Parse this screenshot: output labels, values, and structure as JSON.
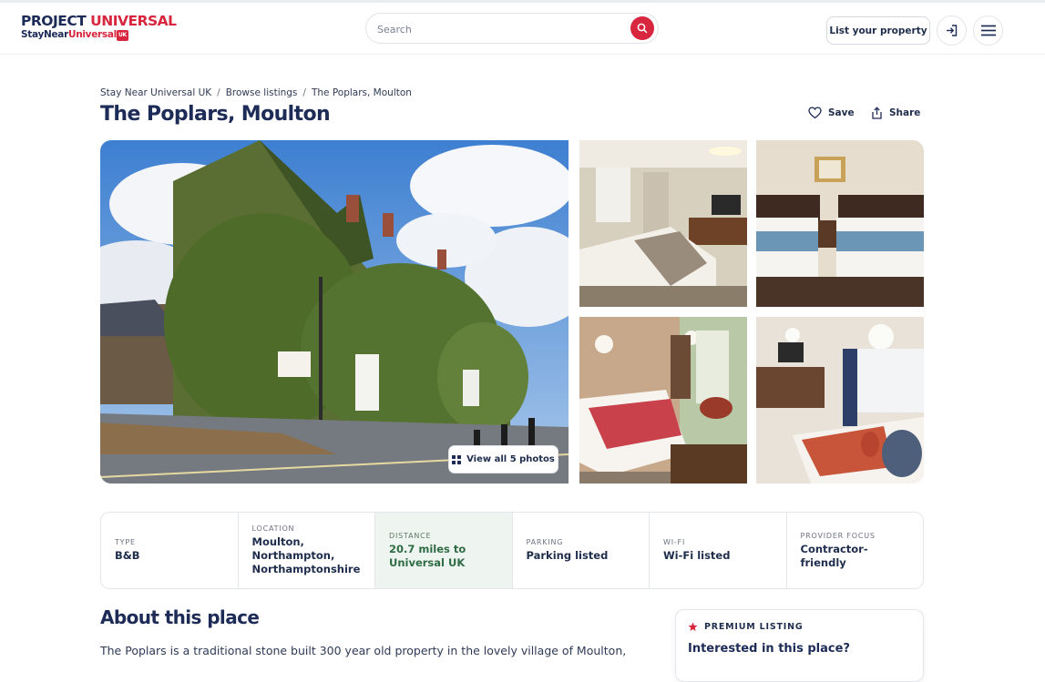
{
  "header": {
    "logo_main_a": "PROJECT ",
    "logo_main_b": "UNIVERSAL",
    "logo_sub_a": "StayNear",
    "logo_sub_b": "Universal",
    "logo_sub_tag": "UK",
    "search_placeholder": "Search",
    "list_property_label": "List your property"
  },
  "breadcrumb": [
    "Stay Near Universal UK",
    "Browse listings",
    "The Poplars, Moulton"
  ],
  "breadcrumb_separator": "/",
  "listing": {
    "title": "The Poplars, Moulton",
    "save_label": "Save",
    "share_label": "Share",
    "view_all_label": "View all 5 photos"
  },
  "facts": [
    {
      "label": "TYPE",
      "value": "B&B"
    },
    {
      "label": "LOCATION",
      "value": "Moulton, Northampton, Northamptonshire"
    },
    {
      "label": "DISTANCE",
      "value": "20.7 miles to Universal UK"
    },
    {
      "label": "PARKING",
      "value": "Parking listed"
    },
    {
      "label": "WI-FI",
      "value": "Wi-Fi listed"
    },
    {
      "label": "PROVIDER FOCUS",
      "value": "Contractor-friendly"
    }
  ],
  "about": {
    "title": "About this place",
    "text": "The Poplars is a traditional stone built 300 year old property in the lovely village of Moulton,"
  },
  "premium": {
    "label": "PREMIUM LISTING",
    "heading": "Interested in this place?"
  },
  "icons": {
    "search": "search-icon",
    "login": "login-icon",
    "menu": "menu-icon",
    "save": "heart-icon",
    "share": "share-icon",
    "grid": "grid-icon",
    "premium": "star-icon"
  },
  "colors": {
    "brand_navy": "#1d2b57",
    "accent_red": "#d7263d",
    "distance_green": "#2f6b45"
  }
}
